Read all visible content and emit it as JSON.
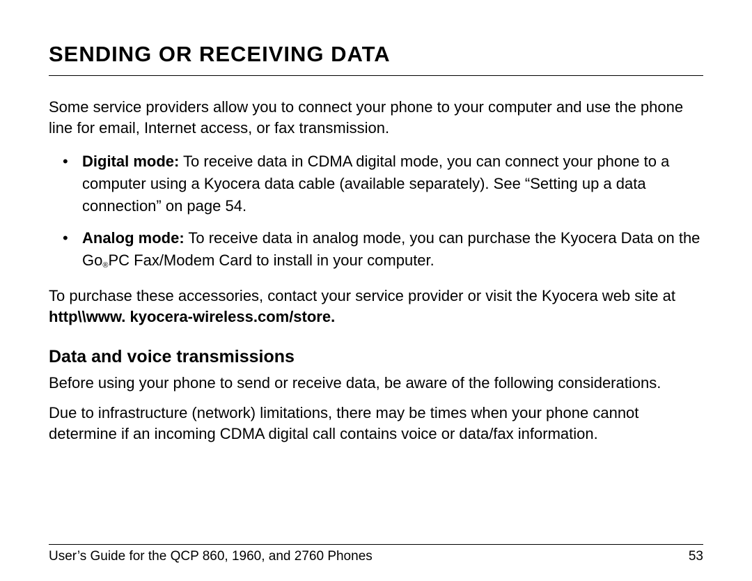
{
  "title": "SENDING OR RECEIVING DATA",
  "intro": "Some service providers allow you to connect your phone to your computer and use the phone line for email, Internet access, or fax transmission.",
  "bullets": {
    "digital": {
      "label": "Digital mode:",
      "text": " To receive data in CDMA digital mode, you can connect your phone to a computer using a Kyocera data cable (available separately). See “Setting up a data connection” on page 54."
    },
    "analog": {
      "label": "Analog mode:",
      "text_before": " To receive data in analog mode, you can purchase the Kyocera Data on the Go",
      "reg": "®",
      "text_after": "PC Fax/Modem Card to install in your computer."
    }
  },
  "purchase": {
    "text": "To purchase these accessories, contact your service provider or visit the Kyocera web site at ",
    "url": "http\\\\www. kyocera-wireless.com/store."
  },
  "subheading": "Data and voice transmissions",
  "para1": "Before using your phone to send or receive data, be aware of the following considerations.",
  "para2": "Due to infrastructure (network) limitations, there may be times when your phone cannot determine if an incoming CDMA digital call contains voice or data/fax information.",
  "footer": {
    "left": "User’s Guide for the QCP 860, 1960, and 2760 Phones",
    "right": "53"
  }
}
